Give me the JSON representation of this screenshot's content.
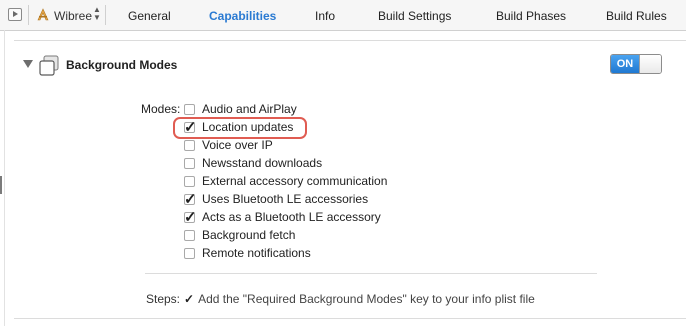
{
  "toolbar": {
    "target_name": "Wibree",
    "tabs": [
      {
        "label": "General",
        "active": false
      },
      {
        "label": "Capabilities",
        "active": true
      },
      {
        "label": "Info",
        "active": false
      },
      {
        "label": "Build Settings",
        "active": false
      },
      {
        "label": "Build Phases",
        "active": false
      },
      {
        "label": "Build Rules",
        "active": false
      }
    ]
  },
  "section": {
    "title": "Background Modes",
    "toggle_label": "ON",
    "toggle_on": true
  },
  "modes": {
    "label": "Modes:",
    "items": [
      {
        "label": "Audio and AirPlay",
        "checked": false
      },
      {
        "label": "Location updates",
        "checked": true,
        "highlighted": true
      },
      {
        "label": "Voice over IP",
        "checked": false
      },
      {
        "label": "Newsstand downloads",
        "checked": false
      },
      {
        "label": "External accessory communication",
        "checked": false
      },
      {
        "label": "Uses Bluetooth LE accessories",
        "checked": true
      },
      {
        "label": "Acts as a Bluetooth LE accessory",
        "checked": true
      },
      {
        "label": "Background fetch",
        "checked": false
      },
      {
        "label": "Remote notifications",
        "checked": false
      }
    ]
  },
  "steps": {
    "label": "Steps:",
    "check": "✓",
    "text": "Add the \"Required Background Modes\" key to your info plist file"
  },
  "colors": {
    "accent": "#2a7ad2",
    "highlight": "#e05c52"
  }
}
